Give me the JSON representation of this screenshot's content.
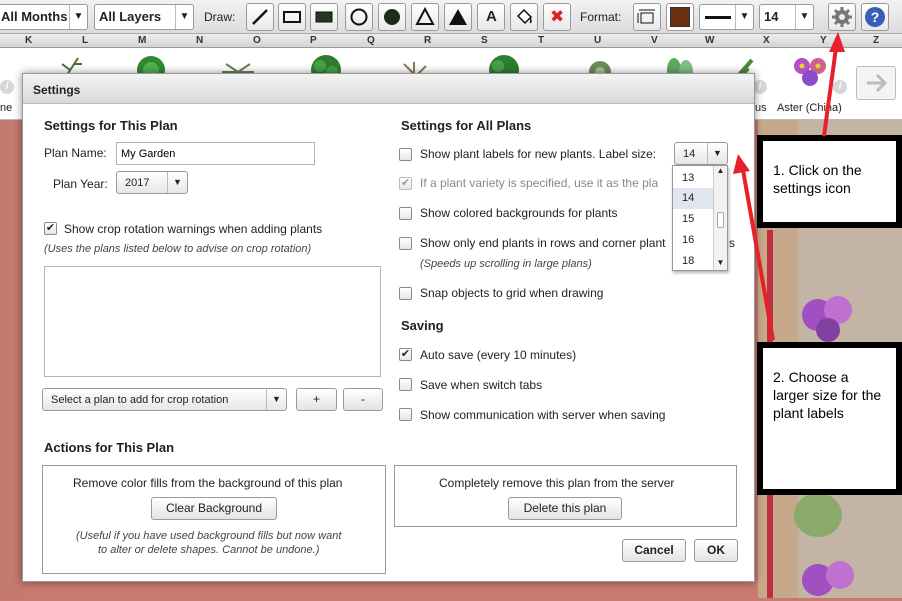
{
  "toolbar": {
    "months_select": "All Months",
    "layers_select": "All Layers",
    "draw_label": "Draw:",
    "format_label": "Format:",
    "font_size": "14",
    "text_tool_glyph": "A",
    "delete_glyph": "✖",
    "colors": {
      "fill_swatch": "#6b2e0e",
      "settings_icon": "#555555",
      "help_icon": "#3a5db8",
      "delete": "#e02020"
    }
  },
  "grid_letters": [
    "K",
    "L",
    "M",
    "N",
    "O",
    "P",
    "Q",
    "R",
    "S",
    "T",
    "U",
    "V",
    "W",
    "X",
    "Y",
    "Z"
  ],
  "plant_strip": {
    "left_label": "ne",
    "us_label": "us",
    "aster_label": "Aster (China)",
    "info_glyph": "i"
  },
  "dialog": {
    "title": "Settings",
    "this_plan": {
      "heading": "Settings for This Plan",
      "plan_name_label": "Plan Name:",
      "plan_name_value": "My Garden",
      "plan_year_label": "Plan Year:",
      "plan_year_value": "2017",
      "crop_rotation_label": "Show crop rotation warnings when adding plants",
      "crop_rotation_checked": true,
      "crop_rotation_note": "(Uses the plans listed below to advise on crop rotation)",
      "add_plan_select": "Select a plan to add for crop rotation",
      "plus_label": "+",
      "minus_label": "-"
    },
    "all_plans": {
      "heading": "Settings for All Plans",
      "show_labels": "Show plant labels for new plants.  Label size:",
      "label_size_value": "14",
      "variety_label": "If a plant variety is specified, use it as the pla",
      "colored_bg": "Show colored backgrounds for plants",
      "end_plants": "Show only end plants in rows and corner plant",
      "end_plants_tail": "s",
      "end_plants_note": "(Speeds up scrolling in large plans)",
      "snap_grid": "Snap objects to grid when drawing"
    },
    "size_dropdown": {
      "options": [
        "13",
        "14",
        "15",
        "16",
        "18"
      ],
      "selected": "14"
    },
    "saving": {
      "heading": "Saving",
      "auto_save": "Auto save (every 10 minutes)",
      "switch_tabs": "Save when switch tabs",
      "communication": "Show communication with server when saving"
    },
    "actions": {
      "heading": "Actions for This Plan",
      "remove_fills": "Remove color fills from the background of this plan",
      "clear_background": "Clear Background",
      "clear_note_1": "(Useful if you have used background fills but now want",
      "clear_note_2": "to alter or delete shapes. Cannot be undone.)",
      "remove_plan": "Completely remove this plan from the server",
      "delete_plan": "Delete this plan"
    },
    "cancel_label": "Cancel",
    "ok_label": "OK"
  },
  "callouts": {
    "step1": "1. Click on the settings icon",
    "step2": "2. Choose a larger size for the plant labels"
  },
  "accent_color": "#e8202a"
}
